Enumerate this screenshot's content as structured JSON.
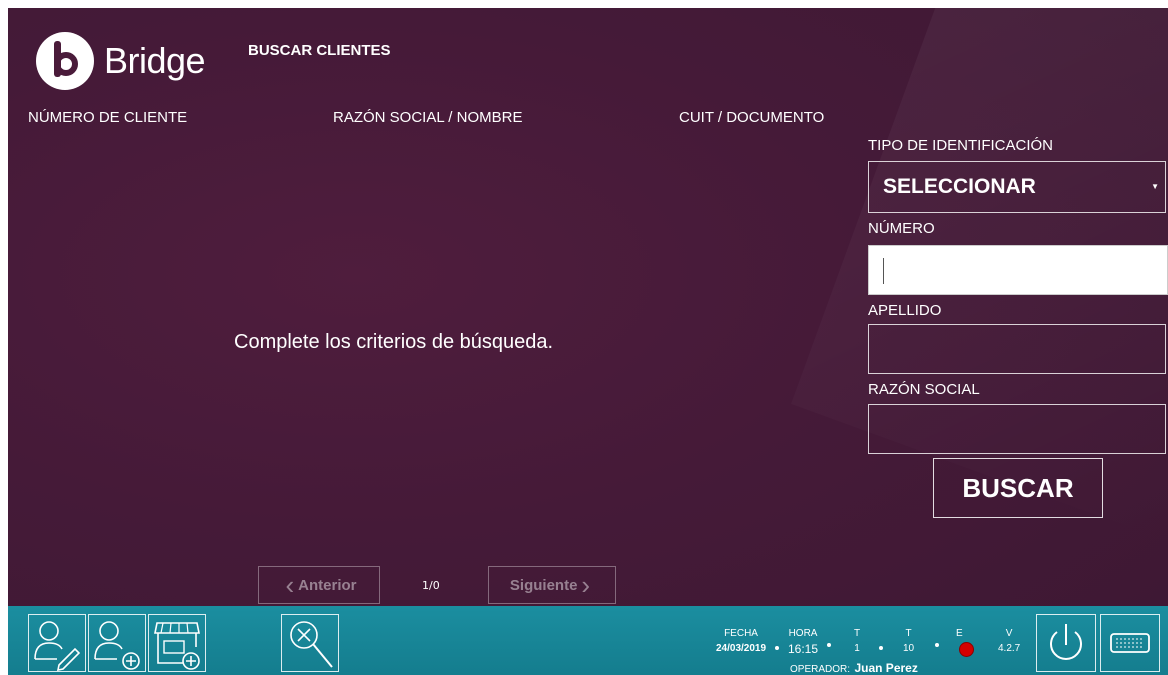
{
  "app": {
    "name": "Bridge",
    "page_title": "BUSCAR CLIENTES"
  },
  "columns": [
    "NÚMERO DE CLIENTE",
    "RAZÓN SOCIAL / NOMBRE",
    "CUIT / DOCUMENTO"
  ],
  "results": {
    "empty_message": "Complete los criterios de búsqueda."
  },
  "search_form": {
    "id_type_label": "TIPO DE IDENTIFICACIÓN",
    "id_type_value": "SELECCIONAR",
    "number_label": "NÚMERO",
    "number_value": "",
    "surname_label": "APELLIDO",
    "surname_value": "",
    "business_name_label": "RAZÓN SOCIAL",
    "business_name_value": "",
    "search_button": "BUSCAR"
  },
  "pagination": {
    "prev": "Anterior",
    "next": "Siguiente",
    "count": "1/0"
  },
  "status_bar": {
    "fecha_label": "FECHA",
    "fecha": "24/03/2019",
    "hora_label": "HORA",
    "hora": "16:15",
    "t1_label": "T",
    "t1": "1",
    "t2_label": "T",
    "t2": "10",
    "e_label": "E",
    "v_label": "V",
    "v": "4.2.7",
    "operator_label": "OPERADOR:",
    "operator": "Juan Perez"
  },
  "colors": {
    "background": "#451a38",
    "toolbar": "#1b8ea0",
    "status_error": "#d40000"
  },
  "toolbar_icons": [
    "edit-client-icon",
    "add-client-icon",
    "add-store-icon",
    "clear-search-icon",
    "power-icon",
    "keyboard-icon"
  ]
}
